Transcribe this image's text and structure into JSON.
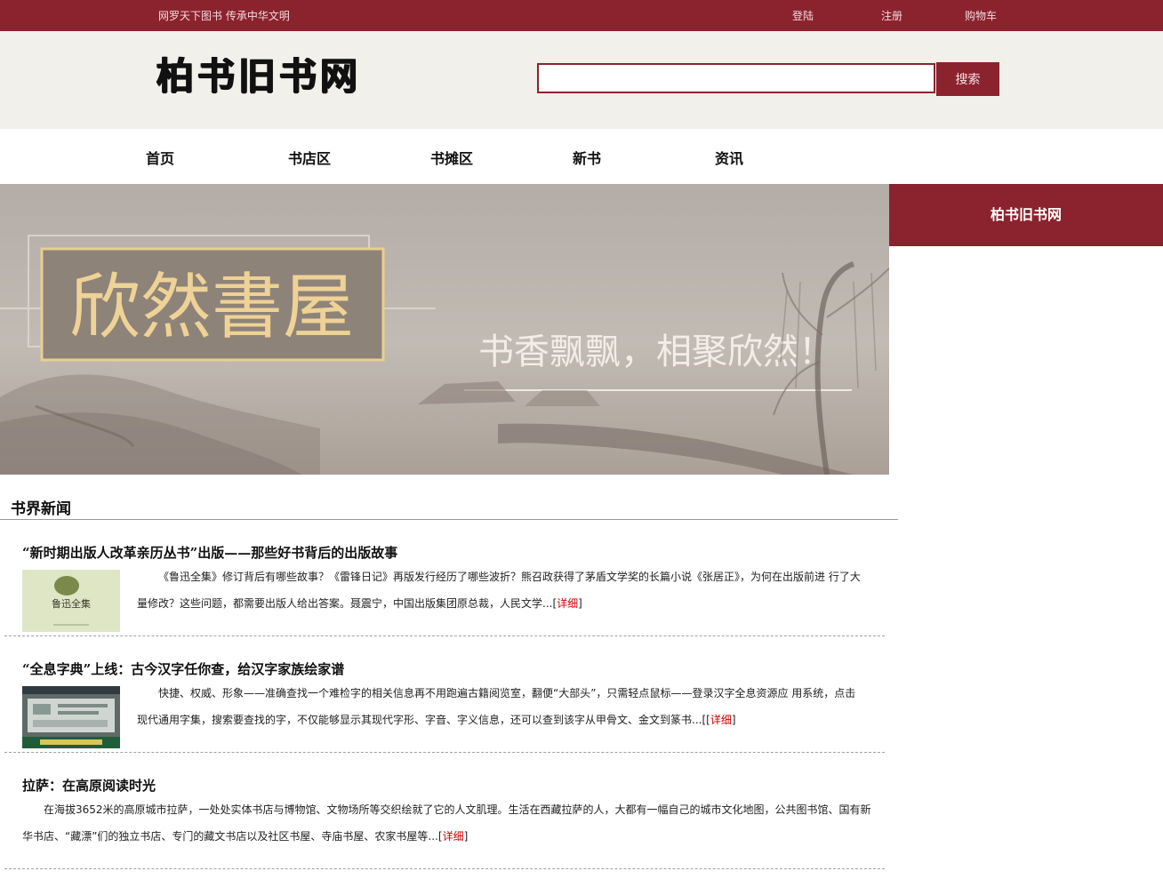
{
  "topbar": {
    "slogan": "网罗天下图书  传承中华文明",
    "links": [
      "登陆",
      "注册",
      "购物车"
    ]
  },
  "header": {
    "logo_text": "柏书旧书网",
    "search_placeholder": "",
    "search_label": "搜索"
  },
  "nav": [
    "首页",
    "书店区",
    "书摊区",
    "新书",
    "资讯"
  ],
  "banner": {
    "title": "欣然書屋",
    "tagline": "书香飘飘，相聚欣然！"
  },
  "sidebar": {
    "title": "柏书旧书网"
  },
  "news_section": {
    "title": "书界新闻",
    "items": [
      {
        "title": "“新时期出版人改革亲历丛书”出版——那些好书背后的出版故事",
        "text": "《鲁迅全集》修订背后有哪些故事？《雷锋日记》再版发行经历了哪些波折？熊召政获得了茅盾文学奖的长篇小说《张居正》，为何在出版前进 行了大量修改？这些问题，都需要出版人给出答案。聂震宁，中国出版集团原总裁，人民文学...",
        "more_open": "[",
        "more": "详细",
        "more_close": "]",
        "thumb_text": "鲁迅全集"
      },
      {
        "title": "“全息字典”上线：古今汉字任你查，给汉字家族绘家谱",
        "text": "快捷、权威、形象——准确查找一个难检字的相关信息再不用跑遍古籍阅览室，翻便“大部头”，只需轻点鼠标——登录汉字全息资源应 用系统，点击现代通用字集，搜索要查找的字，不仅能够显示其现代字形、字音、字义信息，还可以查到该字从甲骨文、金文到篆书...",
        "more_open": "[[",
        "more": "详细",
        "more_close": "]"
      },
      {
        "title": "拉萨：在高原阅读时光",
        "text": "在海拔3652米的高原城市拉萨，一处处实体书店与博物馆、文物场所等交织绘就了它的人文肌理。生活在西藏拉萨的人，大都有一幅自己的城市文化地图，公共图书馆、国有新华书店、“藏漂”们的独立书店、专门的藏文书店以及社区书屋、寺庙书屋、农家书屋等...",
        "more_open": "[",
        "more": "详细",
        "more_close": "]"
      }
    ]
  },
  "colors": {
    "brand": "#8b232e",
    "header_bg": "#f2f0ea",
    "link_red": "#cc0000"
  }
}
